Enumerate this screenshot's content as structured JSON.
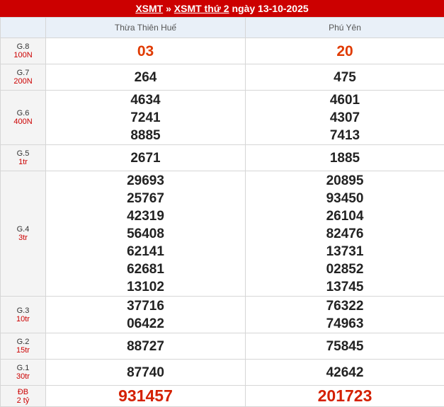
{
  "header": {
    "link1": "XSMT",
    "sep": "»",
    "link2": "XSMT thứ 2",
    "date_text": "ngày 13-10-2025"
  },
  "columns": [
    "Thừa Thiên Huế",
    "Phú Yên"
  ],
  "prizes": [
    {
      "name": "G.8",
      "amount": "100N",
      "col1": [
        "03"
      ],
      "col2": [
        "20"
      ]
    },
    {
      "name": "G.7",
      "amount": "200N",
      "col1": [
        "264"
      ],
      "col2": [
        "475"
      ]
    },
    {
      "name": "G.6",
      "amount": "400N",
      "col1": [
        "4634",
        "7241",
        "8885"
      ],
      "col2": [
        "4601",
        "4307",
        "7413"
      ]
    },
    {
      "name": "G.5",
      "amount": "1tr",
      "col1": [
        "2671"
      ],
      "col2": [
        "1885"
      ]
    },
    {
      "name": "G.4",
      "amount": "3tr",
      "col1": [
        "29693",
        "25767",
        "42319",
        "56408",
        "62141",
        "62681",
        "13102"
      ],
      "col2": [
        "20895",
        "93450",
        "26104",
        "82476",
        "13731",
        "02852",
        "13745"
      ]
    },
    {
      "name": "G.3",
      "amount": "10tr",
      "col1": [
        "37716",
        "06422"
      ],
      "col2": [
        "76322",
        "74963"
      ]
    },
    {
      "name": "G.2",
      "amount": "15tr",
      "col1": [
        "88727"
      ],
      "col2": [
        "75845"
      ]
    },
    {
      "name": "G.1",
      "amount": "30tr",
      "col1": [
        "87740"
      ],
      "col2": [
        "42642"
      ]
    },
    {
      "name": "ĐB",
      "amount": "2 tỷ",
      "col1": [
        "931457"
      ],
      "col2": [
        "201723"
      ]
    }
  ]
}
